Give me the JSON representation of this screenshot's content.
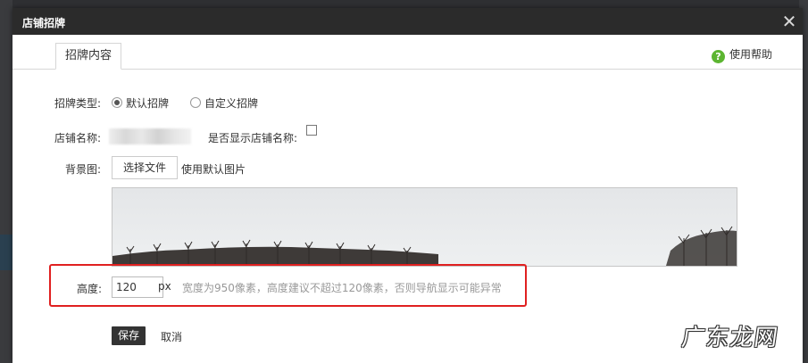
{
  "dialog": {
    "title": "店铺招牌",
    "close_symbol": "✕",
    "tab_label": "招牌内容",
    "help_label": "使用帮助",
    "help_icon_glyph": "?"
  },
  "form": {
    "type_label": "招牌类型:",
    "type_options": [
      "默认招牌",
      "自定义招牌"
    ],
    "selected_type": "默认招牌",
    "shop_name_label": "店铺名称:",
    "show_name_label": "是否显示店铺名称:",
    "show_name_checked": false,
    "bg_label": "背景图:",
    "choose_file_label": "选择文件",
    "default_image_label": "使用默认图片",
    "height_label": "高度:",
    "height_value": "120",
    "height_unit": "px",
    "height_hint": "宽度为950像素，高度建议不超过120像素，否则导航显示可能异常",
    "save_label": "保存",
    "cancel_label": "取消"
  },
  "watermark": "广东龙网",
  "colors": {
    "titlebar": "#2b2b2b",
    "highlight": "#e02020",
    "help_icon": "#5cb531",
    "save_button": "#333333"
  }
}
